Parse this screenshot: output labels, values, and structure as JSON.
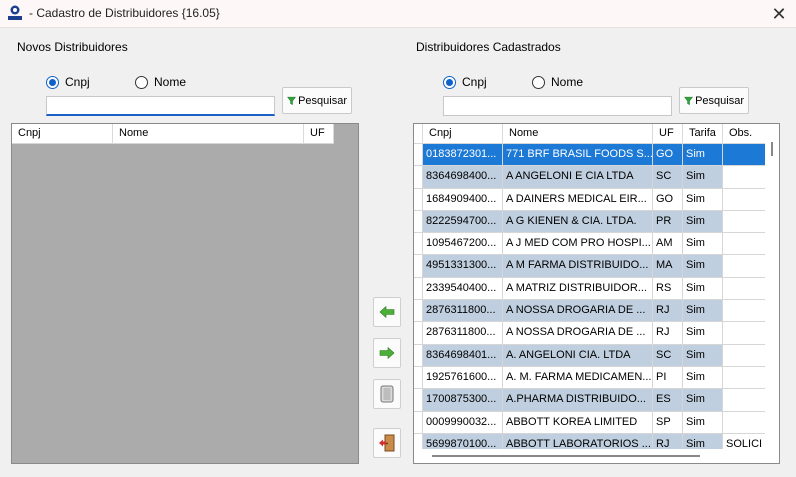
{
  "window": {
    "title": "- Cadastro de Distribuidores {16.05}",
    "icon": "app-logo-icon",
    "close_icon": "close-icon"
  },
  "left": {
    "section_title": "Novos Distribuidores",
    "radio_cnpj": "Cnpj",
    "radio_nome": "Nome",
    "selected_radio": "Cnpj",
    "search_value": "",
    "search_button": "Pesquisar",
    "columns": [
      "Cnpj",
      "Nome",
      "UF"
    ]
  },
  "right": {
    "section_title": "Distribuidores Cadastrados",
    "radio_cnpj": "Cnpj",
    "radio_nome": "Nome",
    "selected_radio": "Cnpj",
    "search_value": "",
    "search_button": "Pesquisar",
    "columns": [
      "Cnpj",
      "Nome",
      "UF",
      "Tarifa",
      "Obs."
    ],
    "rows": [
      {
        "cnpj": "0183872301...",
        "nome": "771 BRF BRASIL FOODS S...",
        "uf": "GO",
        "tarifa": "Sim",
        "obs": ""
      },
      {
        "cnpj": "8364698400...",
        "nome": "A ANGELONI E CIA LTDA",
        "uf": "SC",
        "tarifa": "Sim",
        "obs": ""
      },
      {
        "cnpj": "1684909400...",
        "nome": "A DAINERS MEDICAL EIR...",
        "uf": "GO",
        "tarifa": "Sim",
        "obs": ""
      },
      {
        "cnpj": "8222594700...",
        "nome": "A G KIENEN & CIA. LTDA.",
        "uf": "PR",
        "tarifa": "Sim",
        "obs": ""
      },
      {
        "cnpj": "1095467200...",
        "nome": "A J MED COM PRO HOSPI...",
        "uf": "AM",
        "tarifa": "Sim",
        "obs": ""
      },
      {
        "cnpj": "4951331300...",
        "nome": "A M FARMA DISTRIBUIDO...",
        "uf": "MA",
        "tarifa": "Sim",
        "obs": ""
      },
      {
        "cnpj": "2339540400...",
        "nome": "A MATRIZ DISTRIBUIDOR...",
        "uf": "RS",
        "tarifa": "Sim",
        "obs": ""
      },
      {
        "cnpj": "2876311800...",
        "nome": "A NOSSA DROGARIA DE ...",
        "uf": "RJ",
        "tarifa": "Sim",
        "obs": ""
      },
      {
        "cnpj": "2876311800...",
        "nome": "A NOSSA DROGARIA DE ...",
        "uf": "RJ",
        "tarifa": "Sim",
        "obs": ""
      },
      {
        "cnpj": "8364698401...",
        "nome": "A. ANGELONI CIA. LTDA",
        "uf": "SC",
        "tarifa": "Sim",
        "obs": ""
      },
      {
        "cnpj": "1925761600...",
        "nome": "A. M. FARMA MEDICAMEN...",
        "uf": "PI",
        "tarifa": "Sim",
        "obs": ""
      },
      {
        "cnpj": "1700875300...",
        "nome": "A.PHARMA DISTRIBUIDO...",
        "uf": "ES",
        "tarifa": "Sim",
        "obs": ""
      },
      {
        "cnpj": "0009990032...",
        "nome": "ABBOTT KOREA LIMITED",
        "uf": "SP",
        "tarifa": "Sim",
        "obs": ""
      },
      {
        "cnpj": "5699870100...",
        "nome": "ABBOTT LABORATORIOS ...",
        "uf": "RJ",
        "tarifa": "Sim",
        "obs": "SOLICI"
      }
    ]
  },
  "actions": {
    "move_left_icon": "arrow-left-icon",
    "move_right_icon": "arrow-right-icon",
    "clear_icon": "clear-icon",
    "exit_icon": "exit-door-icon"
  },
  "colors": {
    "accent": "#1d79d6",
    "alt_row": "#bfcfdf",
    "empty_grid": "#ababab"
  }
}
